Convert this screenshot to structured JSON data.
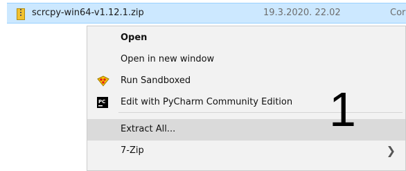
{
  "file": {
    "name": "scrcpy-win64-v1.12.1.zip",
    "date": "19.3.2020. 22.02",
    "type_partial": "Cor",
    "icon": "zip-folder-icon"
  },
  "context_menu": {
    "items": [
      {
        "label": "Open",
        "bold": true
      },
      {
        "label": "Open in new window"
      },
      {
        "label": "Run Sandboxed",
        "icon": "sandboxie-icon"
      },
      {
        "label": "Edit with PyCharm Community Edition",
        "icon": "pycharm-icon"
      },
      {
        "label": "Extract All...",
        "highlighted": true
      },
      {
        "label": "7-Zip",
        "submenu": true,
        "submenu_glyph": "❯"
      }
    ]
  },
  "annotation": {
    "number": "1"
  },
  "colors": {
    "selection": "#cce8ff",
    "menu_bg": "#f2f2f2",
    "hover": "#dadada"
  }
}
